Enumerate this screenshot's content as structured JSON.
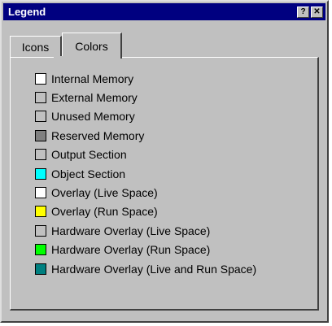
{
  "window": {
    "title": "Legend"
  },
  "title_buttons": {
    "help": "?",
    "close": "✕"
  },
  "tabs": [
    {
      "label": "Icons",
      "selected": false
    },
    {
      "label": "Colors",
      "selected": true
    }
  ],
  "legend": [
    {
      "label": "Internal Memory",
      "color": "#ffffff"
    },
    {
      "label": "External Memory",
      "color": "#c0c0c0"
    },
    {
      "label": "Unused Memory",
      "color": "#c0c0c0"
    },
    {
      "label": "Reserved Memory",
      "color": "#808080"
    },
    {
      "label": "Output Section",
      "color": "#c0c0c0"
    },
    {
      "label": "Object Section",
      "color": "#00ffff"
    },
    {
      "label": "Overlay (Live Space)",
      "color": "#ffffff"
    },
    {
      "label": "Overlay (Run Space)",
      "color": "#ffff00"
    },
    {
      "label": "Hardware Overlay (Live Space)",
      "color": "#c0c0c0"
    },
    {
      "label": "Hardware Overlay (Run Space)",
      "color": "#00ff00"
    },
    {
      "label": "Hardware Overlay (Live and Run Space)",
      "color": "#008080"
    }
  ]
}
